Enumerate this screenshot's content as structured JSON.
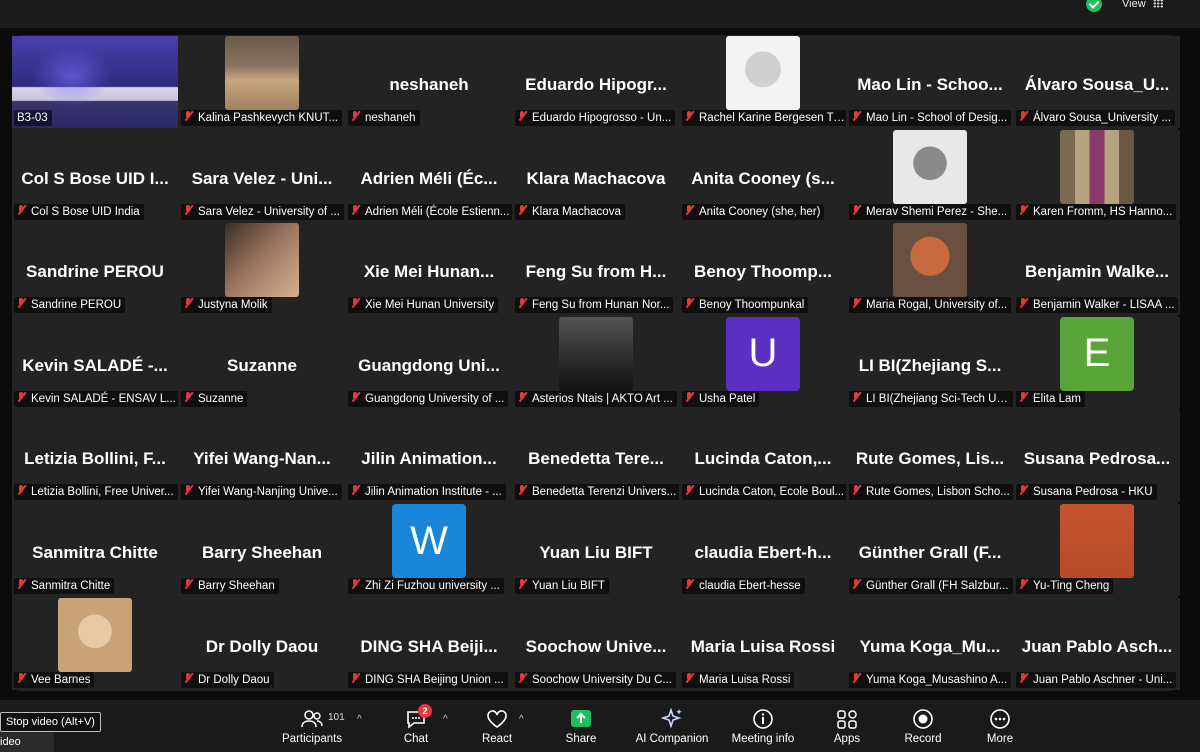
{
  "topbar": {
    "view_label": "View",
    "shield_color": "#1fbf5b"
  },
  "tiles": [
    {
      "label": "B3-03",
      "kind": "video",
      "active": true
    },
    {
      "label": "Kalina Pashkevych KNUT...",
      "kind": "photo",
      "photo": "blonde"
    },
    {
      "name": "neshaneh",
      "label": "neshaneh",
      "kind": "name"
    },
    {
      "name": "Eduardo Hipogr...",
      "label": "Eduardo Hipogrosso - Un...",
      "kind": "name"
    },
    {
      "label": "Rachel Karine Bergesen Tr...",
      "kind": "photo",
      "photo": "bw-glasses"
    },
    {
      "name": "Mao Lin - Schoo...",
      "label": "Mao Lin - School of Desig...",
      "kind": "name"
    },
    {
      "name": "Álvaro Sousa_U...",
      "label": "Álvaro Sousa_University ...",
      "kind": "name"
    },
    {
      "name": "Col S Bose UID I...",
      "label": "Col S Bose UID India",
      "kind": "name"
    },
    {
      "name": "Sara Velez - Uni...",
      "label": "Sara Velez - University of ...",
      "kind": "name"
    },
    {
      "name": "Adrien Méli (Éc...",
      "label": "Adrien Méli (École Estienn...",
      "kind": "name"
    },
    {
      "name": "Klara Machacova",
      "label": "Klara Machacova",
      "kind": "name"
    },
    {
      "name": "Anita Cooney (s...",
      "label": "Anita Cooney (she, her)",
      "kind": "name"
    },
    {
      "label": "Merav Shemi Perez - She...",
      "kind": "photo",
      "photo": "bw-woman"
    },
    {
      "label": "Karen Fromm, HS Hanno...",
      "kind": "photo",
      "photo": "library"
    },
    {
      "name": "Sandrine PEROU",
      "label": "Sandrine PEROU",
      "kind": "name"
    },
    {
      "label": "Justyna Molik",
      "kind": "photo",
      "photo": "face-close"
    },
    {
      "name": "Xie Mei Hunan...",
      "label": "Xie Mei Hunan University",
      "kind": "name"
    },
    {
      "name": "Feng Su from H...",
      "label": "Feng Su from Hunan Nor...",
      "kind": "name"
    },
    {
      "name": "Benoy Thoomp...",
      "label": "Benoy Thoompunkal",
      "kind": "name"
    },
    {
      "label": "Maria Rogal, University of...",
      "kind": "photo",
      "photo": "redhead"
    },
    {
      "name": "Benjamin Walke...",
      "label": "Benjamin Walker - LISAA ...",
      "kind": "name"
    },
    {
      "name": "Kevin SALADÉ -...",
      "label": "Kevin SALADÉ - ENSAV L...",
      "kind": "name"
    },
    {
      "name": "Suzanne",
      "label": "Suzanne",
      "kind": "name"
    },
    {
      "name": "Guangdong Uni...",
      "label": "Guangdong University of ...",
      "kind": "name"
    },
    {
      "label": "Asterios Ntais | AKTO Art ...",
      "kind": "photo",
      "photo": "bw-man"
    },
    {
      "label": "Usha Patel",
      "kind": "letter",
      "letter": "U",
      "color": "#5a2fc2"
    },
    {
      "name": "LI BI(Zhejiang S...",
      "label": "LI BI(Zhejiang Sci-Tech Un...",
      "kind": "name"
    },
    {
      "label": "Elita Lam",
      "kind": "letter",
      "letter": "E",
      "color": "#5aa53a"
    },
    {
      "name": "Letizia Bollini, F...",
      "label": "Letizia Bollini, Free Univer...",
      "kind": "name"
    },
    {
      "name": "Yifei Wang-Nan...",
      "label": "Yifei Wang-Nanjing Unive...",
      "kind": "name"
    },
    {
      "name": "Jilin Animation...",
      "label": "Jilin Animation Institute - ...",
      "kind": "name"
    },
    {
      "name": "Benedetta Tere...",
      "label": "Benedetta Terenzi Univers...",
      "kind": "name"
    },
    {
      "name": "Lucinda Caton,...",
      "label": "Lucinda Caton, Ecole Boul...",
      "kind": "name"
    },
    {
      "name": "Rute Gomes, Lis...",
      "label": "Rute Gomes, Lisbon Scho...",
      "kind": "name"
    },
    {
      "name": "Susana Pedrosa...",
      "label": "Susana Pedrosa - HKU",
      "kind": "name"
    },
    {
      "name": "Sanmitra Chitte",
      "label": "Sanmitra Chitte",
      "kind": "name"
    },
    {
      "name": "Barry Sheehan",
      "label": "Barry Sheehan",
      "kind": "name"
    },
    {
      "label": "Zhi Zi Fuzhou university ...",
      "kind": "letter",
      "letter": "W",
      "color": "#1a86d8"
    },
    {
      "name": "Yuan Liu BIFT",
      "label": "Yuan Liu BIFT",
      "kind": "name"
    },
    {
      "name": "claudia Ebert-h...",
      "label": "claudia Ebert-hesse",
      "kind": "name"
    },
    {
      "name": "Günther Grall (F...",
      "label": "Günther Grall (FH Salzbur...",
      "kind": "name"
    },
    {
      "label": "Yu-Ting Cheng",
      "kind": "photo",
      "photo": "orange"
    },
    {
      "label": "Vee Barnes",
      "kind": "photo",
      "photo": "smile"
    },
    {
      "name": "Dr Dolly Daou",
      "label": "Dr Dolly Daou",
      "kind": "name"
    },
    {
      "name": "DING SHA Beiji...",
      "label": "DING SHA Beijing Union ...",
      "kind": "name"
    },
    {
      "name": "Soochow Unive...",
      "label": "Soochow University Du C...",
      "kind": "name"
    },
    {
      "name": "Maria Luisa Rossi",
      "label": "Maria Luisa Rossi",
      "kind": "name"
    },
    {
      "name": "Yuma Koga_Mu...",
      "label": "Yuma Koga_Musashino A...",
      "kind": "name"
    },
    {
      "name": "Juan Pablo Asch...",
      "label": "Juan Pablo Aschner - Uni...",
      "kind": "name"
    }
  ],
  "toolbar": {
    "participants_label": "Participants",
    "participants_count": "101",
    "chat_label": "Chat",
    "chat_badge": "2",
    "react_label": "React",
    "share_label": "Share",
    "ai_label": "AI Companion",
    "meeting_info_label": "Meeting info",
    "apps_label": "Apps",
    "record_label": "Record",
    "more_label": "More",
    "share_color": "#1fbf5b"
  },
  "tooltip": "Stop video (Alt+V)",
  "video_partial": "ideo"
}
